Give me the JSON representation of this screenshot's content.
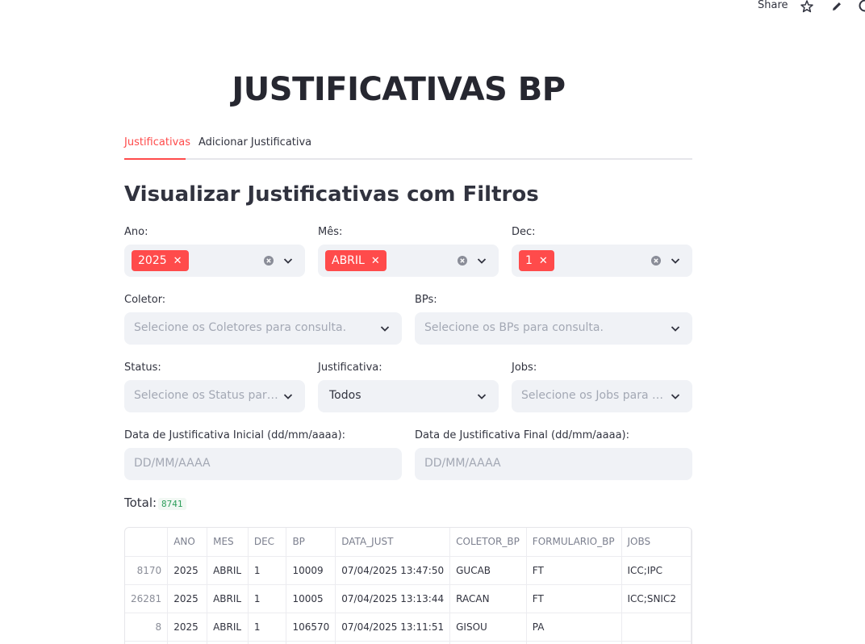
{
  "toolbar": {
    "share_label": "Share"
  },
  "page": {
    "title": "JUSTIFICATIVAS BP"
  },
  "tabs": [
    {
      "label": "Justificativas",
      "active": true
    },
    {
      "label": "Adicionar Justificativa",
      "active": false
    }
  ],
  "section": {
    "subtitle": "Visualizar Justificativas com Filtros"
  },
  "filters": {
    "ano": {
      "label": "Ano:",
      "selected": "2025"
    },
    "mes": {
      "label": "Mês:",
      "selected": "ABRIL"
    },
    "dec": {
      "label": "Dec:",
      "selected": "1"
    },
    "coletor": {
      "label": "Coletor:",
      "placeholder": "Selecione os Coletores para consulta."
    },
    "bps": {
      "label": "BPs:",
      "placeholder": "Selecione os BPs para consulta."
    },
    "status": {
      "label": "Status:",
      "placeholder": "Selecione os Status para…"
    },
    "justificativa": {
      "label": "Justificativa:",
      "value": "Todos"
    },
    "jobs": {
      "label": "Jobs:",
      "placeholder": "Selecione os Jobs para c…"
    },
    "data_inicial": {
      "label": "Data de Justificativa Inicial (dd/mm/aaaa):",
      "placeholder": "DD/MM/AAAA"
    },
    "data_final": {
      "label": "Data de Justificativa Final (dd/mm/aaaa):",
      "placeholder": "DD/MM/AAAA"
    }
  },
  "total": {
    "label": "Total:",
    "value": "8741"
  },
  "table": {
    "columns": [
      "",
      "ANO",
      "MES",
      "DEC",
      "BP",
      "DATA_JUST",
      "COLETOR_BP",
      "FORMULARIO_BP",
      "JOBS"
    ],
    "rows": [
      [
        "8170",
        "2025",
        "ABRIL",
        "1",
        "10009",
        "07/04/2025 13:47:50",
        "GUCAB",
        "FT",
        "ICC;IPC"
      ],
      [
        "26281",
        "2025",
        "ABRIL",
        "1",
        "10005",
        "07/04/2025 13:13:44",
        "RACAN",
        "FT",
        "ICC;SNIC2"
      ],
      [
        "8",
        "2025",
        "ABRIL",
        "1",
        "106570",
        "07/04/2025 13:11:51",
        "GISOU",
        "PA",
        ""
      ]
    ]
  },
  "colors": {
    "accent": "#ff4b4b",
    "input_bg": "#f0f2f6",
    "text": "#31333f"
  }
}
